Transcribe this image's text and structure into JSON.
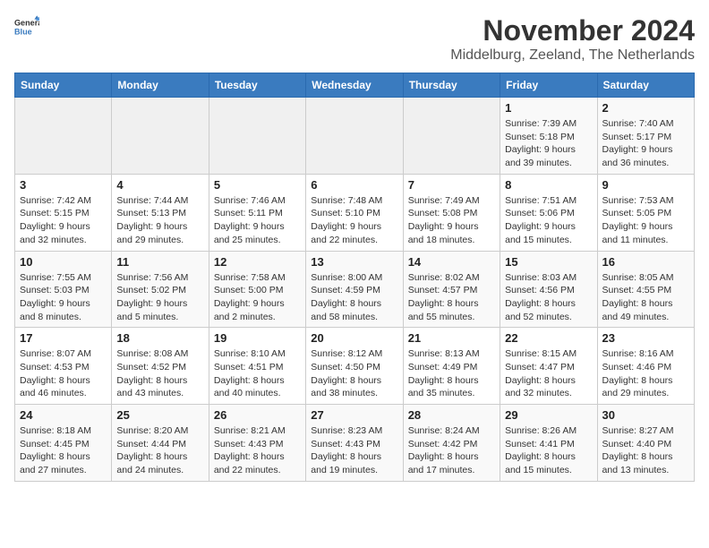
{
  "logo": {
    "text_general": "General",
    "text_blue": "Blue"
  },
  "title": "November 2024",
  "location": "Middelburg, Zeeland, The Netherlands",
  "days_of_week": [
    "Sunday",
    "Monday",
    "Tuesday",
    "Wednesday",
    "Thursday",
    "Friday",
    "Saturday"
  ],
  "weeks": [
    [
      {
        "day": "",
        "info": ""
      },
      {
        "day": "",
        "info": ""
      },
      {
        "day": "",
        "info": ""
      },
      {
        "day": "",
        "info": ""
      },
      {
        "day": "",
        "info": ""
      },
      {
        "day": "1",
        "info": "Sunrise: 7:39 AM\nSunset: 5:18 PM\nDaylight: 9 hours and 39 minutes."
      },
      {
        "day": "2",
        "info": "Sunrise: 7:40 AM\nSunset: 5:17 PM\nDaylight: 9 hours and 36 minutes."
      }
    ],
    [
      {
        "day": "3",
        "info": "Sunrise: 7:42 AM\nSunset: 5:15 PM\nDaylight: 9 hours and 32 minutes."
      },
      {
        "day": "4",
        "info": "Sunrise: 7:44 AM\nSunset: 5:13 PM\nDaylight: 9 hours and 29 minutes."
      },
      {
        "day": "5",
        "info": "Sunrise: 7:46 AM\nSunset: 5:11 PM\nDaylight: 9 hours and 25 minutes."
      },
      {
        "day": "6",
        "info": "Sunrise: 7:48 AM\nSunset: 5:10 PM\nDaylight: 9 hours and 22 minutes."
      },
      {
        "day": "7",
        "info": "Sunrise: 7:49 AM\nSunset: 5:08 PM\nDaylight: 9 hours and 18 minutes."
      },
      {
        "day": "8",
        "info": "Sunrise: 7:51 AM\nSunset: 5:06 PM\nDaylight: 9 hours and 15 minutes."
      },
      {
        "day": "9",
        "info": "Sunrise: 7:53 AM\nSunset: 5:05 PM\nDaylight: 9 hours and 11 minutes."
      }
    ],
    [
      {
        "day": "10",
        "info": "Sunrise: 7:55 AM\nSunset: 5:03 PM\nDaylight: 9 hours and 8 minutes."
      },
      {
        "day": "11",
        "info": "Sunrise: 7:56 AM\nSunset: 5:02 PM\nDaylight: 9 hours and 5 minutes."
      },
      {
        "day": "12",
        "info": "Sunrise: 7:58 AM\nSunset: 5:00 PM\nDaylight: 9 hours and 2 minutes."
      },
      {
        "day": "13",
        "info": "Sunrise: 8:00 AM\nSunset: 4:59 PM\nDaylight: 8 hours and 58 minutes."
      },
      {
        "day": "14",
        "info": "Sunrise: 8:02 AM\nSunset: 4:57 PM\nDaylight: 8 hours and 55 minutes."
      },
      {
        "day": "15",
        "info": "Sunrise: 8:03 AM\nSunset: 4:56 PM\nDaylight: 8 hours and 52 minutes."
      },
      {
        "day": "16",
        "info": "Sunrise: 8:05 AM\nSunset: 4:55 PM\nDaylight: 8 hours and 49 minutes."
      }
    ],
    [
      {
        "day": "17",
        "info": "Sunrise: 8:07 AM\nSunset: 4:53 PM\nDaylight: 8 hours and 46 minutes."
      },
      {
        "day": "18",
        "info": "Sunrise: 8:08 AM\nSunset: 4:52 PM\nDaylight: 8 hours and 43 minutes."
      },
      {
        "day": "19",
        "info": "Sunrise: 8:10 AM\nSunset: 4:51 PM\nDaylight: 8 hours and 40 minutes."
      },
      {
        "day": "20",
        "info": "Sunrise: 8:12 AM\nSunset: 4:50 PM\nDaylight: 8 hours and 38 minutes."
      },
      {
        "day": "21",
        "info": "Sunrise: 8:13 AM\nSunset: 4:49 PM\nDaylight: 8 hours and 35 minutes."
      },
      {
        "day": "22",
        "info": "Sunrise: 8:15 AM\nSunset: 4:47 PM\nDaylight: 8 hours and 32 minutes."
      },
      {
        "day": "23",
        "info": "Sunrise: 8:16 AM\nSunset: 4:46 PM\nDaylight: 8 hours and 29 minutes."
      }
    ],
    [
      {
        "day": "24",
        "info": "Sunrise: 8:18 AM\nSunset: 4:45 PM\nDaylight: 8 hours and 27 minutes."
      },
      {
        "day": "25",
        "info": "Sunrise: 8:20 AM\nSunset: 4:44 PM\nDaylight: 8 hours and 24 minutes."
      },
      {
        "day": "26",
        "info": "Sunrise: 8:21 AM\nSunset: 4:43 PM\nDaylight: 8 hours and 22 minutes."
      },
      {
        "day": "27",
        "info": "Sunrise: 8:23 AM\nSunset: 4:43 PM\nDaylight: 8 hours and 19 minutes."
      },
      {
        "day": "28",
        "info": "Sunrise: 8:24 AM\nSunset: 4:42 PM\nDaylight: 8 hours and 17 minutes."
      },
      {
        "day": "29",
        "info": "Sunrise: 8:26 AM\nSunset: 4:41 PM\nDaylight: 8 hours and 15 minutes."
      },
      {
        "day": "30",
        "info": "Sunrise: 8:27 AM\nSunset: 4:40 PM\nDaylight: 8 hours and 13 minutes."
      }
    ]
  ]
}
